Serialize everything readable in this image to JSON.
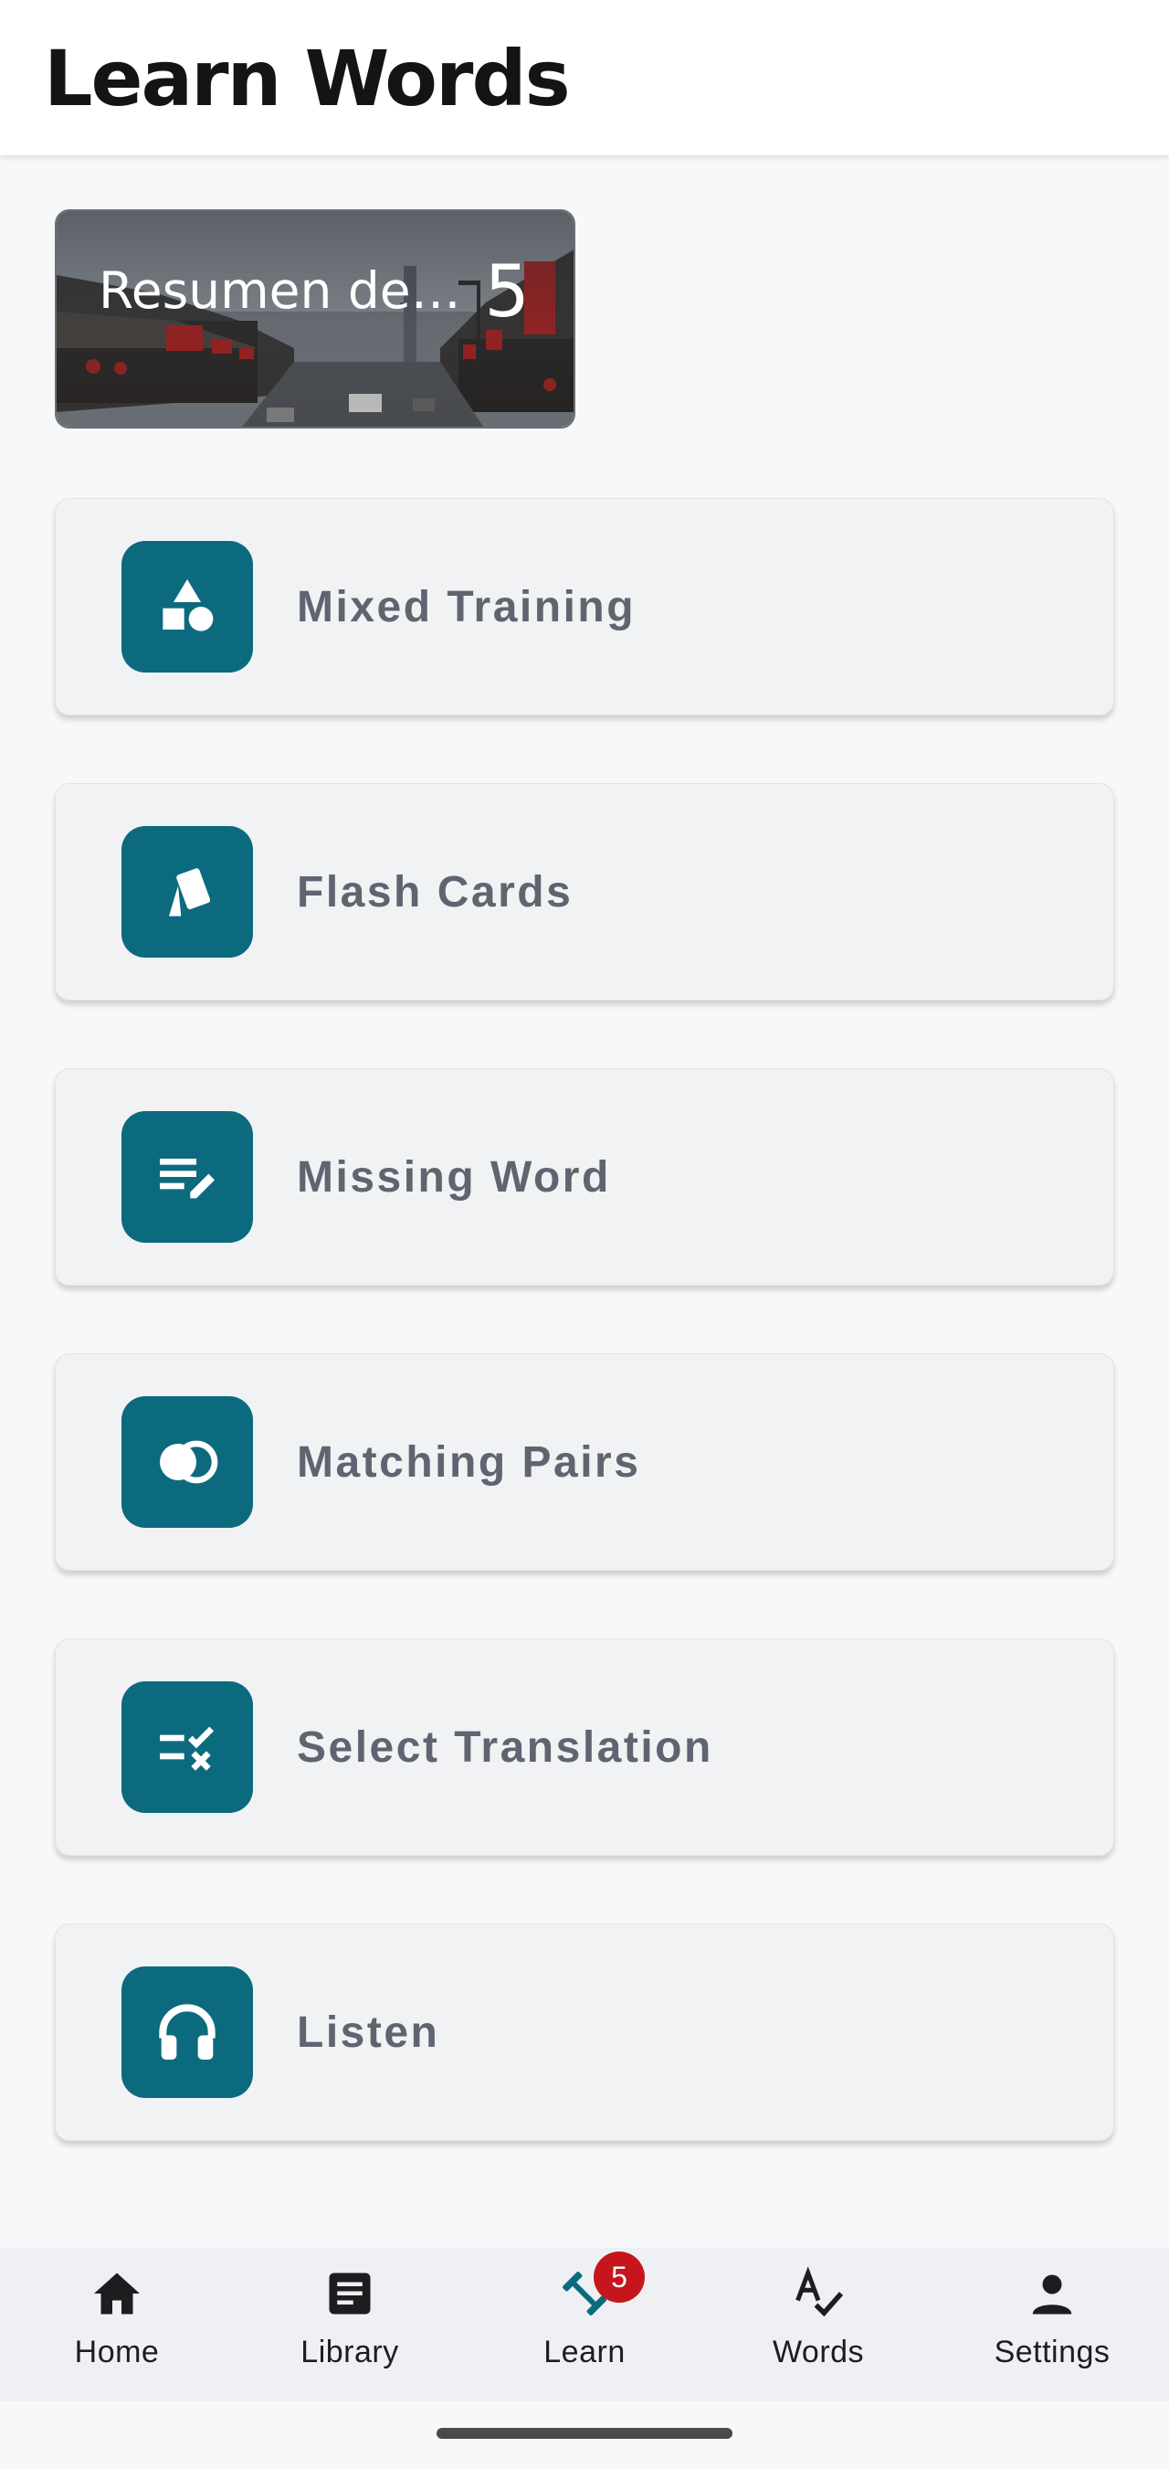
{
  "header": {
    "title": "Learn Words"
  },
  "set_card": {
    "title": "Resumen de Viaje a China",
    "count": "5"
  },
  "activities": [
    {
      "label": "Mixed Training",
      "icon": "shapes-icon"
    },
    {
      "label": "Flash Cards",
      "icon": "cards-icon"
    },
    {
      "label": "Missing Word",
      "icon": "edit-note-icon"
    },
    {
      "label": "Matching Pairs",
      "icon": "overlapping-circles-icon"
    },
    {
      "label": "Select Translation",
      "icon": "rule-icon"
    },
    {
      "label": "Listen",
      "icon": "headphones-icon"
    }
  ],
  "nav": {
    "items": [
      {
        "label": "Home",
        "icon": "home-icon"
      },
      {
        "label": "Library",
        "icon": "article-icon"
      },
      {
        "label": "Learn",
        "icon": "dumbbell-icon",
        "badge": "5",
        "active": true
      },
      {
        "label": "Words",
        "icon": "spellcheck-icon"
      },
      {
        "label": "Settings",
        "icon": "person-icon"
      }
    ]
  },
  "colors": {
    "accent": "#0c6a7e",
    "badge": "#c4161c",
    "card_bg": "#f1f2f4",
    "page_bg": "#f7f8fa"
  }
}
